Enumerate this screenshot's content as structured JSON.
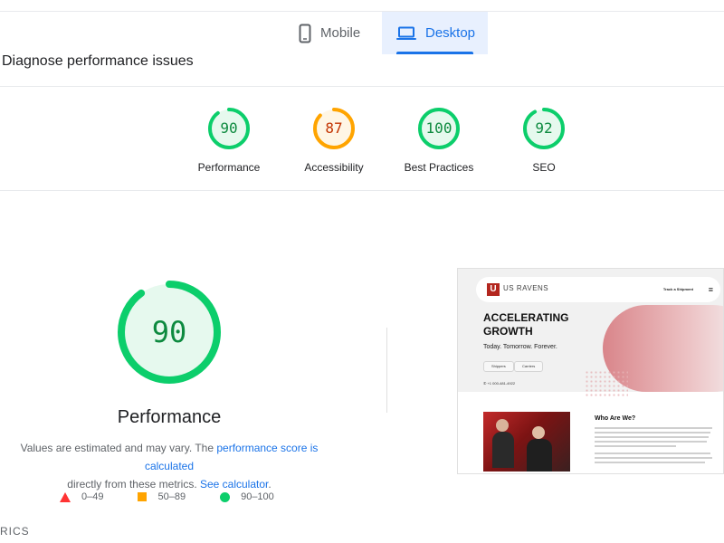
{
  "device_tabs": [
    {
      "label": "Mobile",
      "icon": "phone-icon",
      "selected": false
    },
    {
      "label": "Desktop",
      "icon": "laptop-icon",
      "selected": true
    }
  ],
  "section_title": "Diagnose performance issues",
  "categories": [
    {
      "score": "90",
      "label": "Performance",
      "status": "good",
      "fraction": 0.9
    },
    {
      "score": "87",
      "label": "Accessibility",
      "status": "average",
      "fraction": 0.87
    },
    {
      "score": "100",
      "label": "Best Practices",
      "status": "good",
      "fraction": 1.0
    },
    {
      "score": "92",
      "label": "SEO",
      "status": "good",
      "fraction": 0.92
    }
  ],
  "performance": {
    "score": "90",
    "fraction": 0.9,
    "title": "Performance",
    "note_prefix": "Values are estimated and may vary. The ",
    "note_link1": "performance score is calculated",
    "note_middle": "directly from these metrics. ",
    "note_link2": "See calculator",
    "note_suffix": "."
  },
  "legend": [
    {
      "range": "0–49",
      "shape": "triangle",
      "color": "#ff3333"
    },
    {
      "range": "50–89",
      "shape": "square",
      "color": "#ffa400"
    },
    {
      "range": "90–100",
      "shape": "circle",
      "color": "#0cce6b"
    }
  ],
  "metrics_heading": "RICS",
  "colors": {
    "good": "#0cce6b",
    "good_text": "#0d8a3f",
    "average": "#ffa400",
    "average_text": "#c33300",
    "accent": "#1a73e8"
  },
  "screenshot": {
    "logo_mark": "U",
    "logo_text": "US RAVENS",
    "nav_link": "Track a Shipment",
    "hero_heading": "ACCELERATING GROWTH",
    "hero_sub": "Today. Tomorrow. Forever.",
    "buttons": [
      "Shippers",
      "Carriers"
    ],
    "phone": "+1 000-481-4922",
    "who_heading": "Who Are We?"
  }
}
